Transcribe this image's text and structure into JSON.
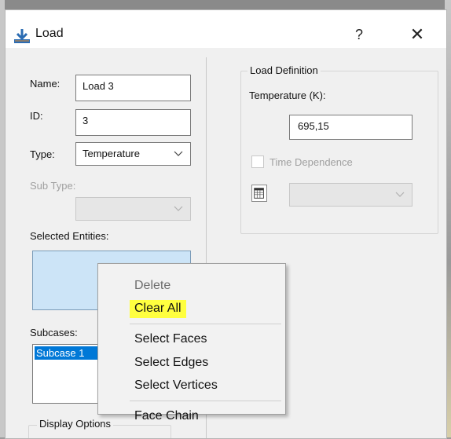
{
  "window": {
    "title": "Load",
    "help_label": "?",
    "close_label": "✕",
    "title_icon": "load-icon"
  },
  "left": {
    "name_label": "Name:",
    "name_value": "Load 3",
    "id_label": "ID:",
    "id_value": "3",
    "type_label": "Type:",
    "type_value": "Temperature",
    "subtype_label": "Sub Type:",
    "subtype_value": "",
    "selected_entities_label": "Selected Entities:",
    "subcases_label": "Subcases:",
    "subcases": [
      "Subcase 1"
    ],
    "display_options_label": "Display Options"
  },
  "right": {
    "group_label": "Load Definition",
    "temperature_label": "Temperature (K):",
    "temperature_value": "695,15",
    "time_dependence_label": "Time Dependence",
    "time_dependence_checked": false,
    "table_icon": "table-icon"
  },
  "context_menu": {
    "items": [
      {
        "label": "Delete",
        "enabled": false
      },
      {
        "label": "Clear All",
        "enabled": true,
        "highlighted": true
      },
      {
        "label": "Select Faces",
        "enabled": true
      },
      {
        "label": "Select Edges",
        "enabled": true
      },
      {
        "label": "Select Vertices",
        "enabled": true
      },
      {
        "label": "Face Chain",
        "enabled": true
      }
    ]
  },
  "colors": {
    "highlight": "#ffff3f",
    "selection": "#0078d7",
    "entities_bg": "#cce4f7"
  }
}
